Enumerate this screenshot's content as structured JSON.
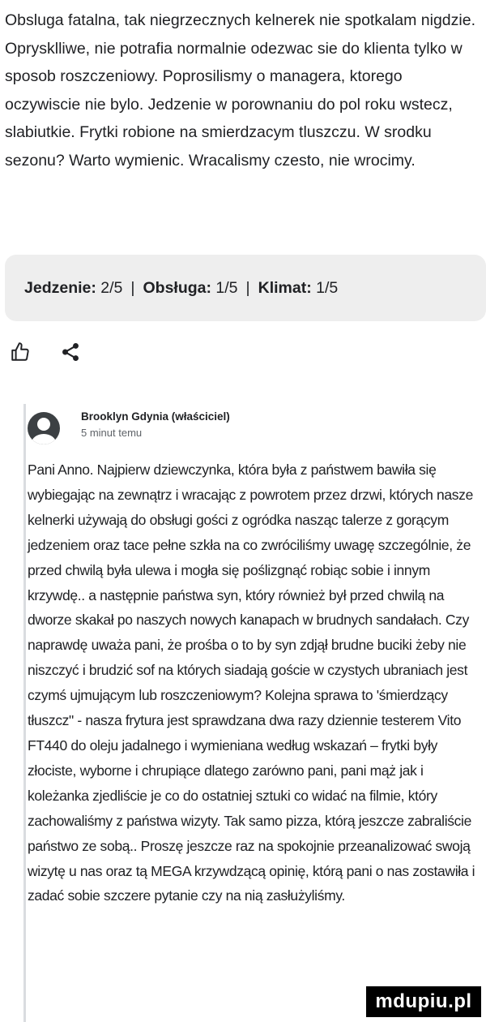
{
  "review": {
    "text": "Obsluga fatalna, tak niegrzecznych kelnerek nie spotkalam nigdzie. Oprysklliwe, nie potrafia normalnie odezwac sie do klienta tylko w sposob roszczeniowy. Poprosilismy o managera, ktorego oczywiscie nie bylo. Jedzenie w porownaniu do pol roku wstecz, slabiutkie. Frytki robione na smierdzacym tluszczu. W srodku sezonu? Warto wymienic. Wracalismy czesto, nie wrocimy."
  },
  "ratings": {
    "food_label": "Jedzenie:",
    "food_value": "2/5",
    "service_label": "Obsługa:",
    "service_value": "1/5",
    "atmosphere_label": "Klimat:",
    "atmosphere_value": "1/5",
    "separator": "|"
  },
  "actions": {
    "like_icon": "thumbs-up-icon",
    "share_icon": "share-icon"
  },
  "owner_reply": {
    "name": "Brooklyn Gdynia (właściciel)",
    "time": "5 minut temu",
    "text": "Pani Anno. Najpierw dziewczynka, która była z państwem bawiła się wybiegając na zewnątrz i wracając z powrotem przez drzwi, których nasze kelnerki używają do obsługi gości z ogródka nasząc talerze z gorącym jedzeniem oraz tace pełne szkła na co zwróciliśmy uwagę szczególnie, że przed chwilą była ulewa i mogła się poślizgnąć robiąc sobie i innym krzywdę.. a następnie państwa syn, który również był przed chwilą na dworze skakał po naszych nowych kanapach w brudnych sandałach. Czy naprawdę uważa pani, że prośba o to by syn zdjął brudne buciki żeby nie niszczyć i brudzić sof na których siadają goście w czystych ubraniach jest czymś ujmującym lub roszczeniowym? Kolejna sprawa to 'śmierdzący tłuszcz\" - nasza frytura jest sprawdzana dwa razy dziennie testerem Vito FT440 do oleju jadalnego i wymieniana według wskazań – frytki były złociste, wyborne i chrupiące dlatego zarówno pani, pani mąż jak i koleżanka zjedliście je co do ostatniej sztuki co widać na filmie, który zachowaliśmy z państwa wizyty. Tak samo pizza, którą jeszcze zabraliście państwo ze sobą.. Proszę jeszcze raz na spokojnie przeanalizować swoją wizytę u nas oraz tą MEGA krzywdzącą opinię, którą pani o nas zostawiła i zadać sobie szczere pytanie czy na nią zasłużyliśmy."
  },
  "watermark": {
    "text": "mdupiu.pl"
  }
}
